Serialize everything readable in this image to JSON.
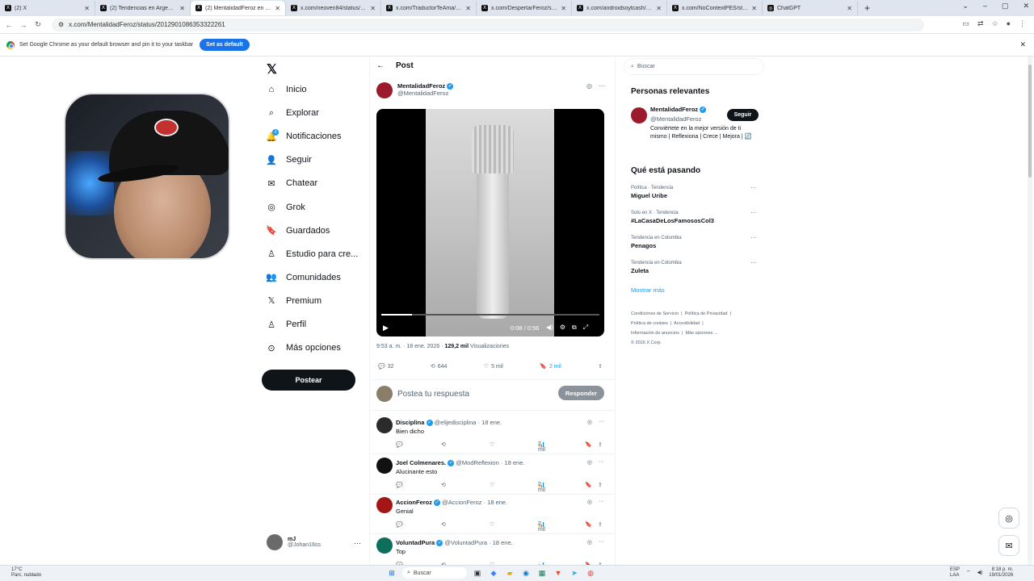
{
  "browser": {
    "tabs": [
      {
        "title": "(2) X",
        "active": false
      },
      {
        "title": "(2) Tendencias en Argentina en",
        "active": false
      },
      {
        "title": "(2) MentalidadFeroz en X: \"http:",
        "active": true
      },
      {
        "title": "x.com/neoven84/status/20130",
        "active": false
      },
      {
        "title": "x.com/TraductorTeAma/status/",
        "active": false
      },
      {
        "title": "x.com/DespertarFeroz/status/2",
        "active": false
      },
      {
        "title": "x.com/androidsoytcash/status/",
        "active": false
      },
      {
        "title": "x.com/NoContextPES/status/20",
        "active": false
      },
      {
        "title": "ChatGPT",
        "active": false
      }
    ],
    "url": "x.com/MentalidadFeroz/status/2012901086353322261",
    "infobar_text": "Set Google Chrome as your default browser and pin it to your taskbar",
    "infobar_button": "Set as default"
  },
  "nav": {
    "items": [
      {
        "label": "Inicio",
        "icon": "home-icon"
      },
      {
        "label": "Explorar",
        "icon": "search-icon"
      },
      {
        "label": "Notificaciones",
        "icon": "bell-icon",
        "badge": "3"
      },
      {
        "label": "Seguir",
        "icon": "person-add-icon"
      },
      {
        "label": "Chatear",
        "icon": "mail-icon"
      },
      {
        "label": "Grok",
        "icon": "grok-icon"
      },
      {
        "label": "Guardados",
        "icon": "bookmark-icon"
      },
      {
        "label": "Estudio para cre...",
        "icon": "studio-icon"
      },
      {
        "label": "Comunidades",
        "icon": "people-icon"
      },
      {
        "label": "Premium",
        "icon": "x-premium-icon"
      },
      {
        "label": "Perfil",
        "icon": "person-icon"
      },
      {
        "label": "Más opciones",
        "icon": "more-circle-icon"
      }
    ],
    "post_button": "Postear",
    "account": {
      "name": "mJ",
      "handle": "@Johan16ss"
    }
  },
  "post": {
    "header": "Post",
    "author": "MentalidadFeroz",
    "handle": "@MentalidadFeroz",
    "video": {
      "time": "0:08 / 0:56",
      "progress": 0.14
    },
    "timestamp": "9:53 a. m. · 18 ene. 2026 ·",
    "views_count": "129,2 mil",
    "views_label": "Visualizaciones",
    "stats": {
      "replies": "32",
      "reposts": "644",
      "likes": "5 mil",
      "bookmarks": "2 mil"
    },
    "reply_placeholder": "Postea tu respuesta",
    "reply_button": "Responder"
  },
  "replies": [
    {
      "name": "Disciplina",
      "handle": "@elijedisciplina · 18 ene.",
      "text": "Bien dicho",
      "views": "2 mil",
      "color": "#2b2b2b"
    },
    {
      "name": "Joel Colmenares.",
      "handle": "@ModReflexion · 18 ene.",
      "text": "Alucinante esto",
      "views": "2 mil",
      "color": "#111111"
    },
    {
      "name": "AccionFeroz",
      "handle": "@AccionFeroz · 18 ene.",
      "text": "Genial",
      "views": "2 mil",
      "color": "#a31616"
    },
    {
      "name": "VoluntadPura",
      "handle": "@VoluntadPura · 18 ene.",
      "text": "Top",
      "views": "",
      "color": "#0d6e5a"
    }
  ],
  "sidebar": {
    "search_placeholder": "Buscar",
    "relevant_title": "Personas relevantes",
    "relevant": {
      "name": "MentalidadFeroz",
      "handle": "@MentalidadFeroz",
      "bio": "Conviértete en la mejor versión de ti mismo | Reflexiona | Crece | Mejora |",
      "follow": "Seguir"
    },
    "trends_title": "Qué está pasando",
    "trends": [
      {
        "context": "Política · Tendencia",
        "name": "Miguel Uribe"
      },
      {
        "context": "Solo en X · Tendencia",
        "name": "#LaCasaDeLosFamososCol3"
      },
      {
        "context": "Tendencia en Colombia",
        "name": "Penagos"
      },
      {
        "context": "Tendencia en Colombia",
        "name": "Zuleta"
      }
    ],
    "show_more": "Mostrar más",
    "footer": [
      "Condiciones de Servicio",
      "Política de Privacidad",
      "Política de cookies",
      "Accesibilidad",
      "Información de anuncios",
      "Más opciones ...",
      "© 2026 X Corp."
    ]
  },
  "taskbar": {
    "weather_temp": "17°C",
    "weather_desc": "Parc. nublado",
    "search": "Buscar",
    "lang": "ESP",
    "lang2": "LAA",
    "time": "8:18 p. m.",
    "date": "19/01/2026"
  }
}
